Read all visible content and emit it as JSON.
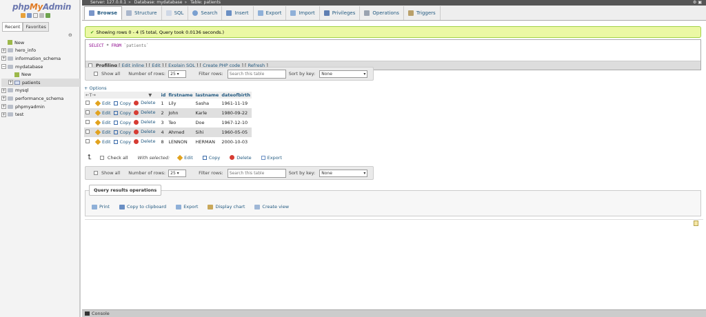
{
  "logo": {
    "php": "php",
    "my": "My",
    "admin": "Admin"
  },
  "nav": {
    "tabs": [
      "Recent",
      "Favorites"
    ],
    "tree": [
      {
        "label": "New",
        "type": "new",
        "indent": 0
      },
      {
        "label": "hero_info",
        "type": "db",
        "indent": 0
      },
      {
        "label": "information_schema",
        "type": "db",
        "indent": 0
      },
      {
        "label": "mydatabase",
        "type": "db",
        "indent": 0
      },
      {
        "label": "New",
        "type": "new",
        "indent": 1
      },
      {
        "label": "patients",
        "type": "table",
        "indent": 1,
        "selected": true
      },
      {
        "label": "mysql",
        "type": "db",
        "indent": 0
      },
      {
        "label": "performance_schema",
        "type": "db",
        "indent": 0
      },
      {
        "label": "phpmyadmin",
        "type": "db",
        "indent": 0
      },
      {
        "label": "test",
        "type": "db",
        "indent": 0
      }
    ]
  },
  "breadcrumb": {
    "server": "Server: 127.0.0.1",
    "database": "Database: mydatabase",
    "table": "Table: patients"
  },
  "menu": {
    "browse": "Browse",
    "structure": "Structure",
    "sql": "SQL",
    "search": "Search",
    "insert": "Insert",
    "export": "Export",
    "import": "Import",
    "privileges": "Privileges",
    "operations": "Operations",
    "triggers": "Triggers"
  },
  "success": "Showing rows 0 - 4 (5 total, Query took 0.0136 seconds.)",
  "sql": {
    "select": "SELECT",
    "star": " * ",
    "from": "FROM",
    "table": " `patients`"
  },
  "profiling": {
    "label": "Profiling",
    "links": [
      "Edit inline",
      "Edit",
      "Explain SQL",
      "Create PHP code",
      "Refresh"
    ]
  },
  "navrow": {
    "show_all": "Show all",
    "rows_label": "Number of rows:",
    "rows_value": "25",
    "filter_label": "Filter rows:",
    "filter_placeholder": "Search this table",
    "sort_label": "Sort by key:",
    "sort_value": "None"
  },
  "options": "+ Options",
  "table": {
    "columns": [
      "id",
      "firstname",
      "lastname",
      "dateofbirth"
    ],
    "rows": [
      {
        "id": "1",
        "firstname": "Lily",
        "lastname": "Sasha",
        "dob": "1961-11-19"
      },
      {
        "id": "2",
        "firstname": "John",
        "lastname": "Karle",
        "dob": "1980-09-22"
      },
      {
        "id": "3",
        "firstname": "Teo",
        "lastname": "Doe",
        "dob": "1967-12-10"
      },
      {
        "id": "4",
        "firstname": "Ahmed",
        "lastname": "Sihi",
        "dob": "1960-05-05"
      },
      {
        "id": "8",
        "firstname": "LENNON",
        "lastname": "HERMAN",
        "dob": "2000-10-03"
      }
    ],
    "edit": "Edit",
    "copy": "Copy",
    "delete": "Delete"
  },
  "with_selected": {
    "check_all": "Check all",
    "label": "With selected:",
    "edit": "Edit",
    "copy": "Copy",
    "delete": "Delete",
    "export": "Export"
  },
  "qro": {
    "legend": "Query results operations",
    "print": "Print",
    "clipboard": "Copy to clipboard",
    "export": "Export",
    "chart": "Display chart",
    "view": "Create view"
  },
  "console": "Console"
}
